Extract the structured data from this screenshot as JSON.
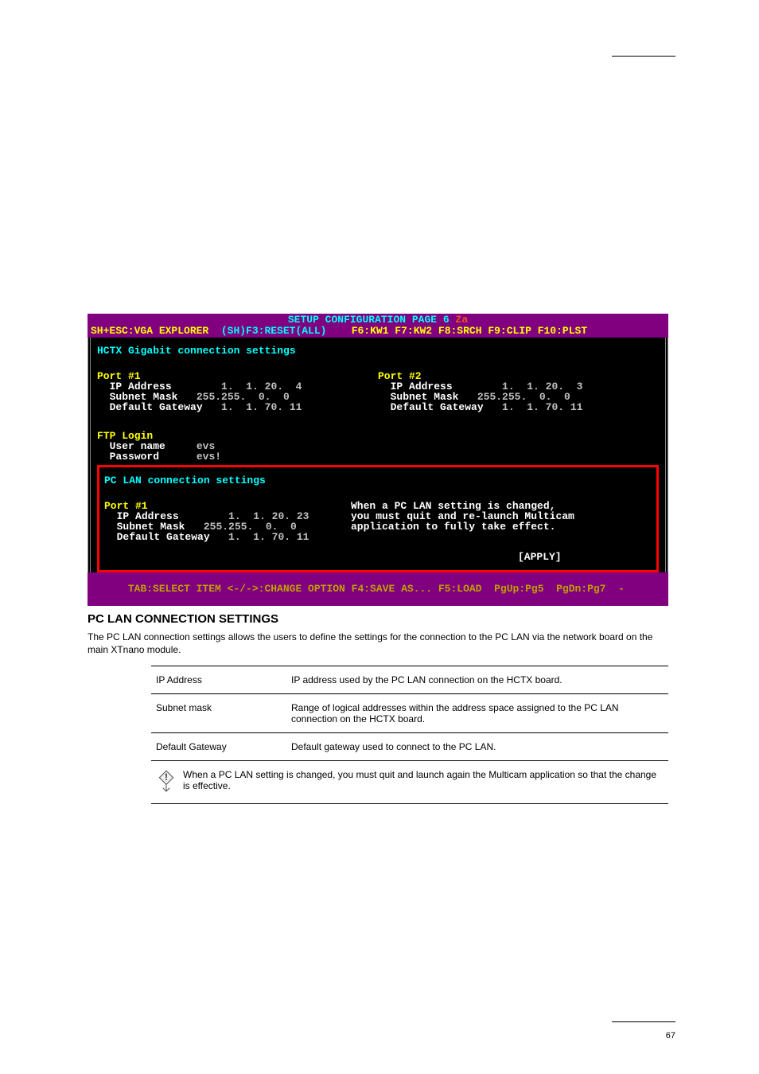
{
  "header": {
    "right_info": ""
  },
  "terminal": {
    "title": "SETUP CONFIGURATION PAGE 6",
    "title_suffix": "Za",
    "menu_left": "SH+ESC:VGA EXPLORER",
    "menu_mid": "(SH)F3:RESET(ALL)",
    "menu_right": "F6:KW1 F7:KW2 F8:SRCH F9:CLIP F10:PLST",
    "section1": "HCTX Gigabit connection settings",
    "port1_title": "Port #1",
    "port2_title": "Port #2",
    "port1": {
      "ip_label": "IP Address",
      "ip": "  1.  1. 20.  4",
      "mask_label": "Subnet Mask",
      "mask": "255.255.  0.  0",
      "gw_label": "Default Gateway",
      "gw": "  1.  1. 70. 11"
    },
    "port2": {
      "ip_label": "IP Address",
      "ip": "  1.  1. 20.  3",
      "mask_label": "Subnet Mask",
      "mask": "255.255.  0.  0",
      "gw_label": "Default Gateway",
      "gw": "  1.  1. 70. 11"
    },
    "ftp_title": "FTP Login",
    "ftp": {
      "user_label": "User name",
      "user": "evs",
      "pw_label": "Password",
      "pw": "evs!"
    },
    "section2": "PC LAN connection settings",
    "pc_port1_title": "Port #1",
    "pc_port1": {
      "ip_label": "IP Address",
      "ip": "  1.  1. 20. 23",
      "mask_label": "Subnet Mask",
      "mask": "255.255.  0.  0",
      "gw_label": "Default Gateway",
      "gw": "  1.  1. 70. 11"
    },
    "help1": "When a PC LAN setting is changed,",
    "help2": "you must quit and re-launch Multicam",
    "help3": "application to fully take effect.",
    "apply": "[APPLY]",
    "footer": "TAB:SELECT ITEM <-/->:CHANGE OPTION F4:SAVE AS... F5:LOAD  PgUp:Pg5  PgDn:Pg7  -"
  },
  "settings_table": {
    "heading": "PC LAN CONNECTION SETTINGS",
    "intro": "The PC LAN connection settings allows the users to define the settings for the connection to the PC LAN via the network board on the main XTnano module.",
    "rows": [
      {
        "label": "IP Address",
        "desc": "IP address used by the PC LAN connection on the HCTX board."
      },
      {
        "label": "Subnet mask",
        "desc": "Range of logical addresses within the address space assigned to the PC LAN connection on the HCTX board."
      },
      {
        "label": "Default Gateway",
        "desc": "Default gateway used to connect to the PC LAN."
      },
      {
        "label": "__NOTE__",
        "desc": "When a PC LAN setting is changed, you must quit and launch again the Multicam application so that the change is effective."
      }
    ]
  },
  "page_number": "67"
}
